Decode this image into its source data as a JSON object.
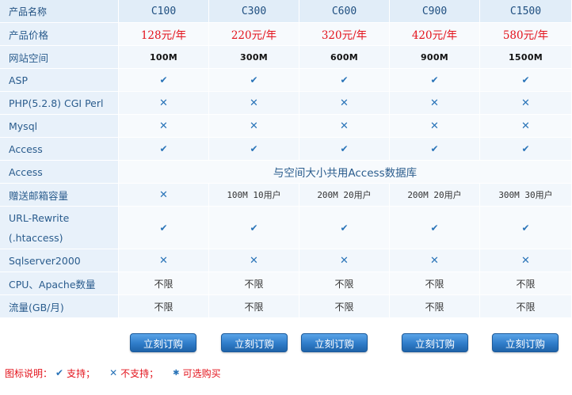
{
  "header": {
    "row_label": "产品名称",
    "plans": [
      "C100",
      "C300",
      "C600",
      "C900",
      "C1500"
    ]
  },
  "rows": {
    "price": {
      "label": "产品价格",
      "values": [
        "128元/年",
        "220元/年",
        "320元/年",
        "420元/年",
        "580元/年"
      ]
    },
    "space": {
      "label": "网站空间",
      "values": [
        "100M",
        "300M",
        "600M",
        "900M",
        "1500M"
      ]
    },
    "asp": {
      "label": "ASP",
      "values": [
        "yes",
        "yes",
        "yes",
        "yes",
        "yes"
      ]
    },
    "php": {
      "label": "PHP(5.2.8) CGI Perl",
      "values": [
        "no",
        "no",
        "no",
        "no",
        "no"
      ]
    },
    "mysql": {
      "label": "Mysql",
      "values": [
        "no",
        "no",
        "no",
        "no",
        "no"
      ]
    },
    "access1": {
      "label": "Access",
      "values": [
        "yes",
        "yes",
        "yes",
        "yes",
        "yes"
      ]
    },
    "access2": {
      "label": "Access",
      "note": "与空间大小共用Access数据库"
    },
    "mailbox": {
      "label": "赠送邮箱容量",
      "values": [
        "no",
        "100M 10用户",
        "200M 20用户",
        "200M 20用户",
        "300M 30用户"
      ]
    },
    "rewrite": {
      "label_line1": "URL-Rewrite",
      "label_line2": "(.htaccess)",
      "values": [
        "yes",
        "yes",
        "yes",
        "yes",
        "yes"
      ]
    },
    "sqlserver": {
      "label": "Sqlserver2000",
      "values": [
        "no",
        "no",
        "no",
        "no",
        "no"
      ]
    },
    "cpu": {
      "label": "CPU、Apache数量",
      "values": [
        "不限",
        "不限",
        "不限",
        "不限",
        "不限"
      ]
    },
    "traffic": {
      "label": "流量(GB/月)",
      "values": [
        "不限",
        "不限",
        "不限",
        "不限",
        "不限"
      ]
    }
  },
  "buy_button_label": "立刻订购",
  "legend": {
    "title": "图标说明：",
    "yes_label": "支持；",
    "no_label": "不支持；",
    "optional_label": "可选购买"
  },
  "icons": {
    "yes": "check-icon",
    "no": "cross-icon",
    "optional": "star-icon"
  },
  "colors": {
    "price_red": "#e3121b",
    "label_blue": "#2a5c8d",
    "icon_blue": "#2a74b8",
    "button_blue": "#2f7cc9"
  }
}
